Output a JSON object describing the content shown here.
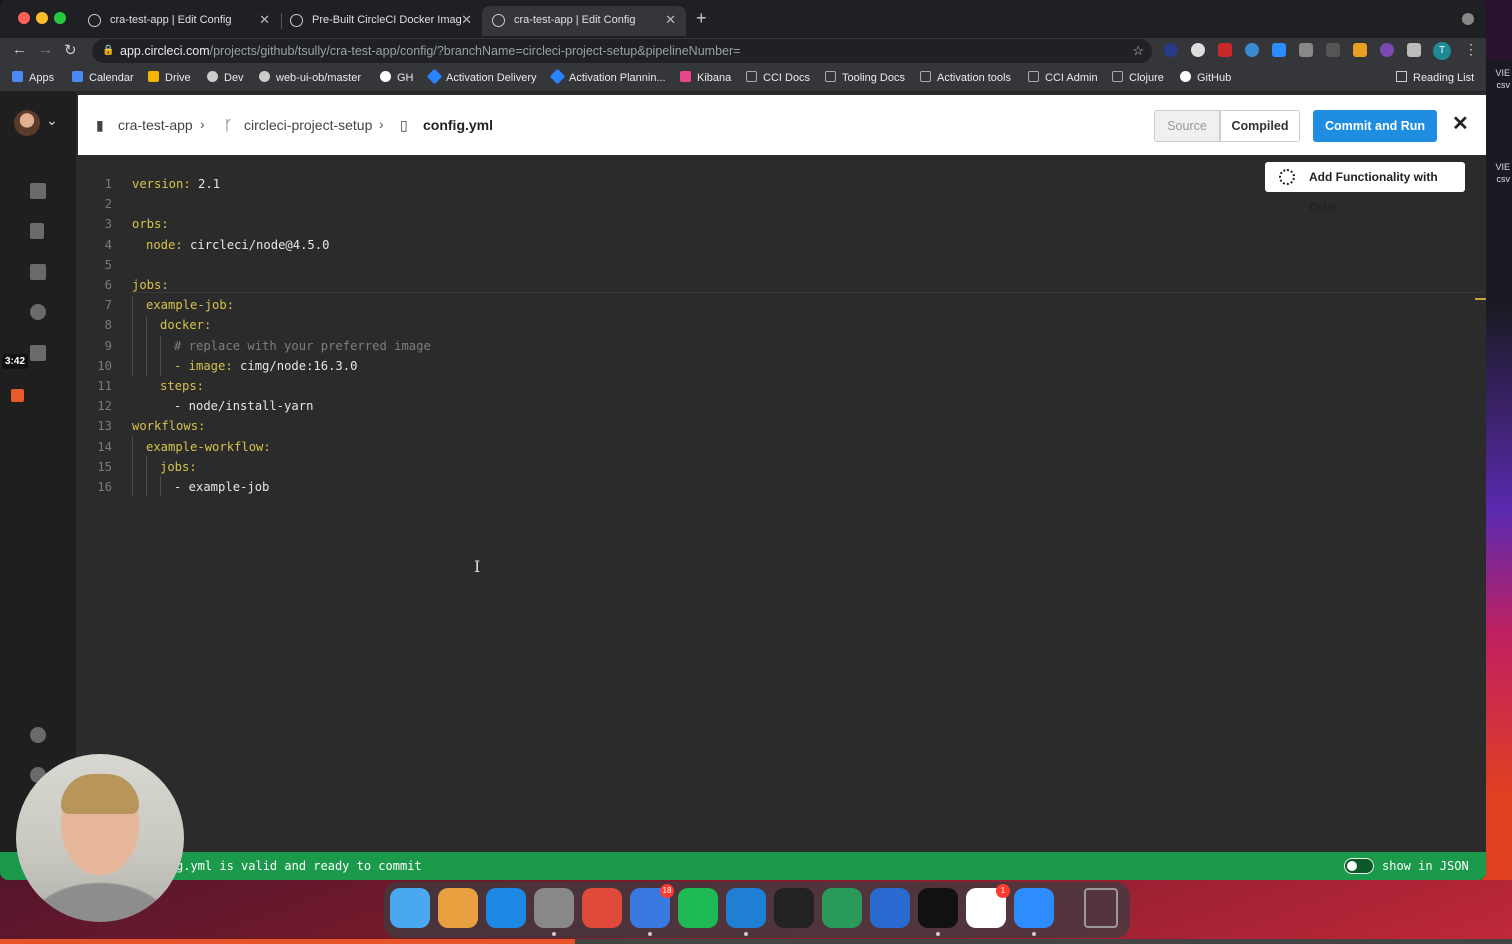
{
  "browser": {
    "tabs": [
      {
        "title": "cra-test-app | Edit Config"
      },
      {
        "title": "Pre-Built CircleCI Docker Imag"
      },
      {
        "title": "cra-test-app | Edit Config"
      }
    ],
    "url_host": "app.circleci.com",
    "url_path": "/projects/github/tsully/cra-test-app/config/?branchName=circleci-project-setup&pipelineNumber=",
    "profile_initial": "T",
    "bookmarks": [
      {
        "label": "Apps",
        "color": "#4a8af4"
      },
      {
        "label": "Calendar",
        "color": "#4a8af4"
      },
      {
        "label": "Drive",
        "color": "#f4b400"
      },
      {
        "label": "Dev",
        "color": "#cccccc"
      },
      {
        "label": "web-ui-ob/master",
        "color": "#cccccc"
      },
      {
        "label": "GH",
        "color": "#ffffff"
      },
      {
        "label": "Activation Delivery",
        "color": "#2684ff"
      },
      {
        "label": "Activation Plannin...",
        "color": "#2684ff"
      },
      {
        "label": "Kibana",
        "color": "#e8478b"
      },
      {
        "label": "CCI Docs",
        "color": "#aaaaaa"
      },
      {
        "label": "Tooling Docs",
        "color": "#aaaaaa"
      },
      {
        "label": "Activation tools",
        "color": "#aaaaaa"
      },
      {
        "label": "CCI Admin",
        "color": "#aaaaaa"
      },
      {
        "label": "Clojure",
        "color": "#aaaaaa"
      },
      {
        "label": "GitHub",
        "color": "#ffffff"
      }
    ],
    "reading_list": "Reading List"
  },
  "breadcrumb": {
    "project": "cra-test-app",
    "branch": "circleci-project-setup",
    "file": "config.yml"
  },
  "toolbar": {
    "source_label": "Source",
    "compiled_label": "Compiled",
    "commit_label": "Commit and Run",
    "close_glyph": "✕"
  },
  "orbs_button": {
    "label": "Add Functionality with Orbs"
  },
  "recording": {
    "time": "3:42",
    "progress_fraction": 0.38
  },
  "editor": {
    "lines": [
      {
        "n": "1",
        "indent": 0,
        "key": "version:",
        "val": " 2.1",
        "comment": ""
      },
      {
        "n": "2",
        "indent": 0,
        "key": "",
        "val": "",
        "comment": ""
      },
      {
        "n": "3",
        "indent": 0,
        "key": "orbs:",
        "val": "",
        "comment": ""
      },
      {
        "n": "4",
        "indent": 1,
        "key": "node:",
        "val": " circleci/node@4.5.0",
        "comment": ""
      },
      {
        "n": "5",
        "indent": 0,
        "key": "",
        "val": "",
        "comment": ""
      },
      {
        "n": "6",
        "indent": 0,
        "key": "jobs:",
        "val": "",
        "comment": ""
      },
      {
        "n": "7",
        "indent": 1,
        "key": "example-job:",
        "val": "",
        "comment": ""
      },
      {
        "n": "8",
        "indent": 2,
        "key": "docker:",
        "val": "",
        "comment": ""
      },
      {
        "n": "9",
        "indent": 3,
        "key": "",
        "val": "",
        "comment": "# replace with your preferred image"
      },
      {
        "n": "10",
        "indent": 3,
        "key": "- image:",
        "val": " cimg/node:16.3.0",
        "comment": ""
      },
      {
        "n": "11",
        "indent": 2,
        "key": "steps:",
        "val": "",
        "comment": ""
      },
      {
        "n": "12",
        "indent": 3,
        "key": "",
        "val": "- node/install-yarn",
        "comment": ""
      },
      {
        "n": "13",
        "indent": 0,
        "key": "workflows:",
        "val": "",
        "comment": ""
      },
      {
        "n": "14",
        "indent": 1,
        "key": "example-workflow:",
        "val": "",
        "comment": ""
      },
      {
        "n": "15",
        "indent": 2,
        "key": "jobs:",
        "val": "",
        "comment": ""
      },
      {
        "n": "16",
        "indent": 3,
        "key": "",
        "val": "- example-job",
        "comment": ""
      }
    ]
  },
  "status": {
    "message": "g.yml is valid and ready to commit",
    "json_toggle_label": "show in JSON"
  },
  "desktop": {
    "labels": [
      "VIE",
      "csv",
      "VIE",
      "csv"
    ]
  },
  "dock": {
    "apps": [
      {
        "name": "finder",
        "color": "#4aa8f0"
      },
      {
        "name": "launchpad",
        "color": "#e8a040"
      },
      {
        "name": "app-store",
        "color": "#1e88e5"
      },
      {
        "name": "system-preferences",
        "color": "#888888"
      },
      {
        "name": "chrome",
        "color": "#e04a3a"
      },
      {
        "name": "tasks",
        "color": "#3a7ae0",
        "badge": "18"
      },
      {
        "name": "spotify",
        "color": "#1db954"
      },
      {
        "name": "vscode",
        "color": "#1f7fd4"
      },
      {
        "name": "circleci",
        "color": "#222222"
      },
      {
        "name": "app-green",
        "color": "#2a9a5a"
      },
      {
        "name": "app-sound",
        "color": "#2a6ad0"
      },
      {
        "name": "terminal",
        "color": "#111111"
      },
      {
        "name": "slack",
        "color": "#ffffff",
        "badge": "1"
      },
      {
        "name": "zoom",
        "color": "#2d8cff"
      },
      {
        "name": "trash",
        "color": "#9a9a9a"
      }
    ]
  }
}
